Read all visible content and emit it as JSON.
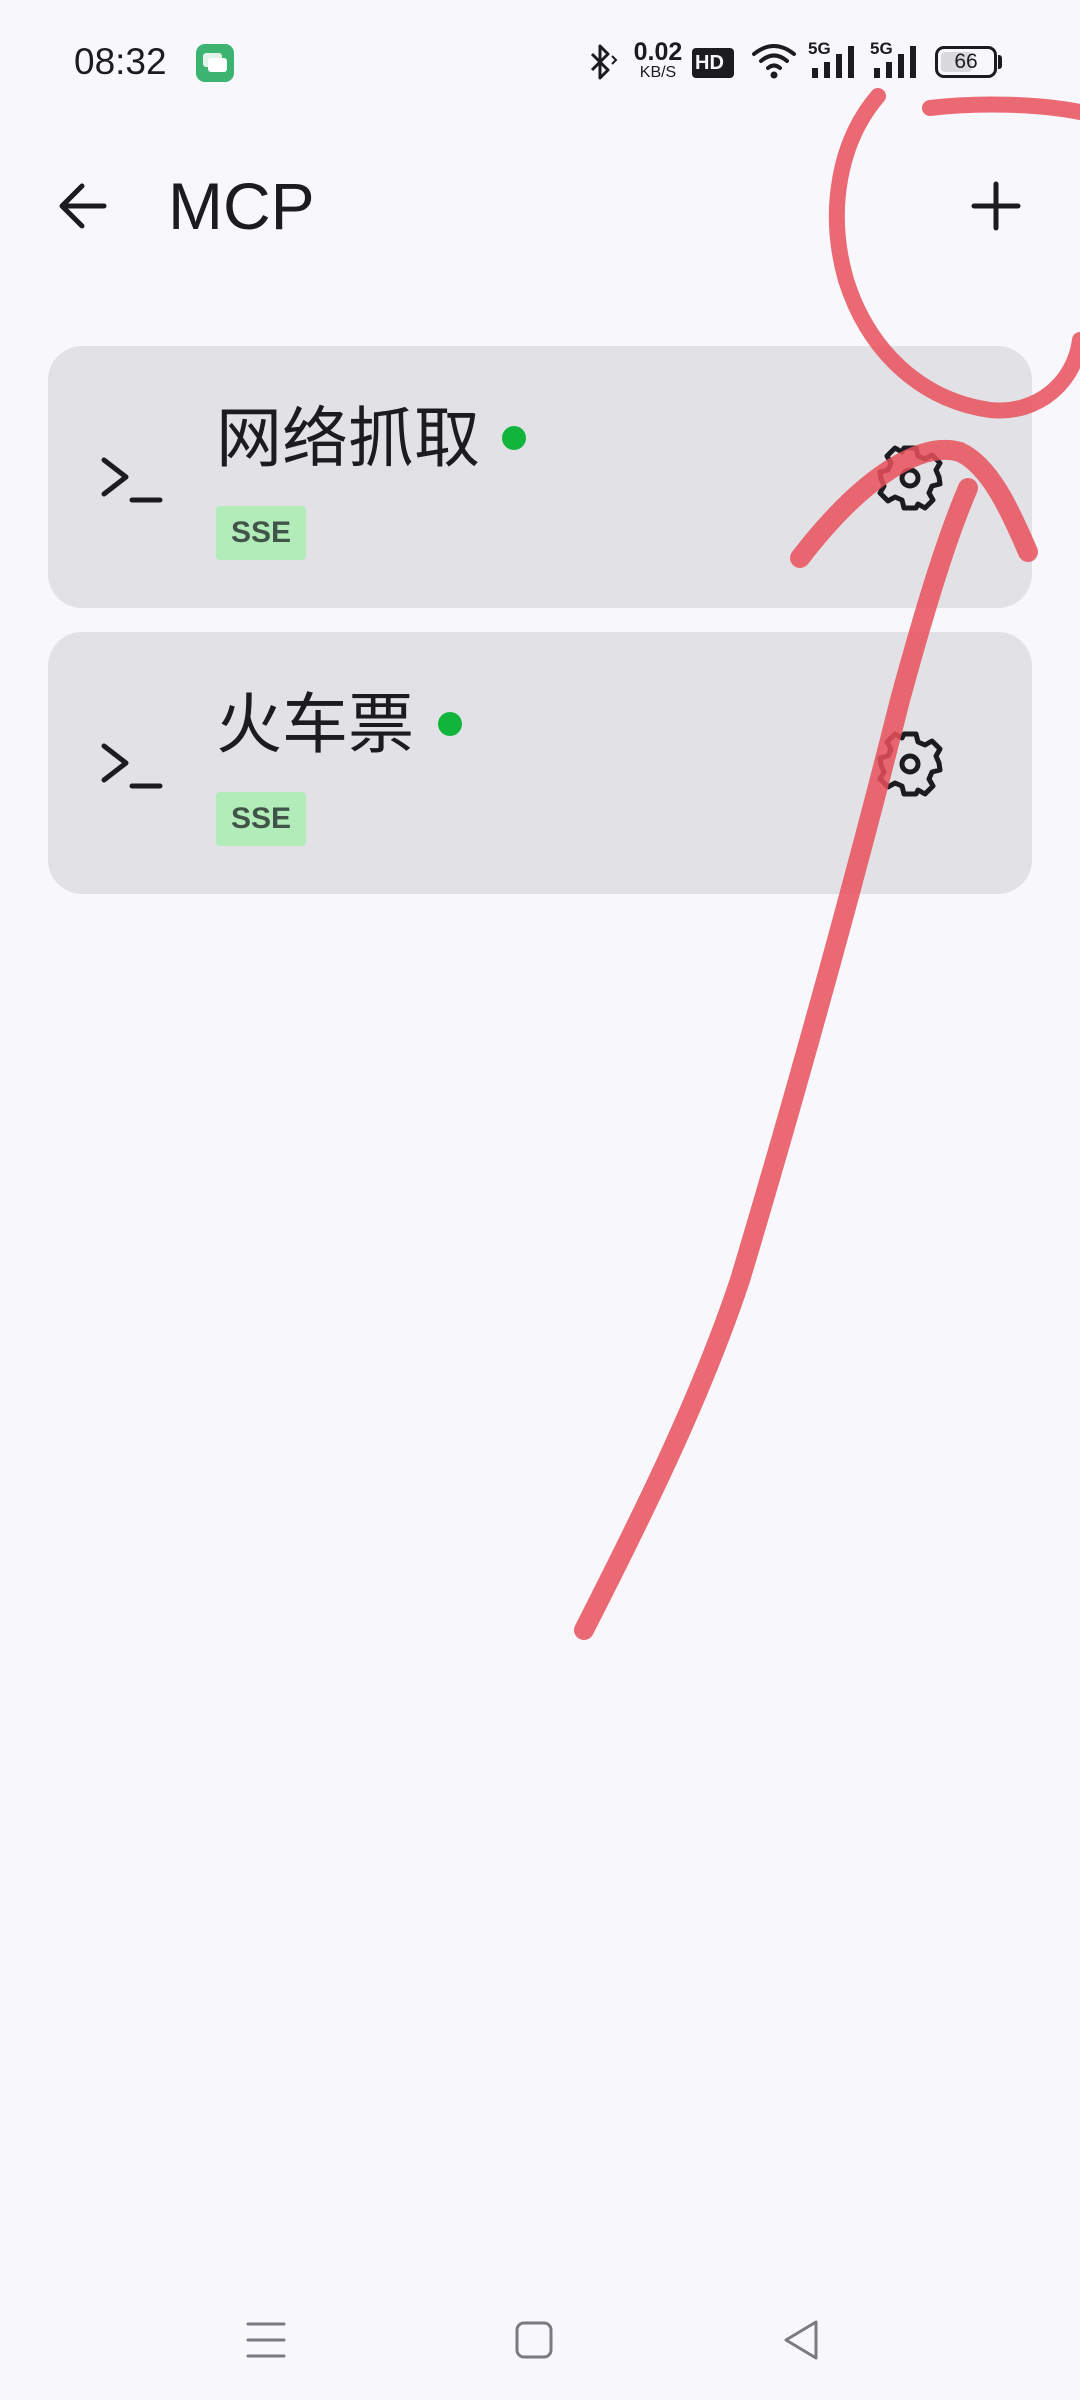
{
  "status_bar": {
    "time": "08:32",
    "net_speed_value": "0.02",
    "net_speed_unit": "KB/S",
    "hd_label": "HD",
    "signal_1_label": "5G",
    "signal_2_label": "5G",
    "battery_level": "66",
    "battery_percent": 66,
    "icons": [
      "message-app-icon",
      "bluetooth-icon",
      "hd-voice-icon",
      "wifi-icon",
      "signal-icon",
      "signal-icon",
      "battery-icon"
    ]
  },
  "app_bar": {
    "title": "MCP",
    "back_icon": "arrow-left-icon",
    "add_icon": "plus-icon"
  },
  "servers": [
    {
      "name": "网络抓取",
      "transport": "SSE",
      "status": "online",
      "status_color": "#11b53b",
      "icon": "terminal-icon",
      "action_icon": "gear-icon"
    },
    {
      "name": "火车票",
      "transport": "SSE",
      "status": "online",
      "status_color": "#11b53b",
      "icon": "terminal-icon",
      "action_icon": "gear-icon"
    }
  ],
  "nav_bar": {
    "icons": [
      "menu-icon",
      "home-icon",
      "back-triangle-icon"
    ]
  },
  "colors": {
    "background": "#f8f7fc",
    "card": "#e2e2e6",
    "badge_bg": "#b2ecb8",
    "badge_text": "#415449",
    "annotation": "#e8505b"
  }
}
